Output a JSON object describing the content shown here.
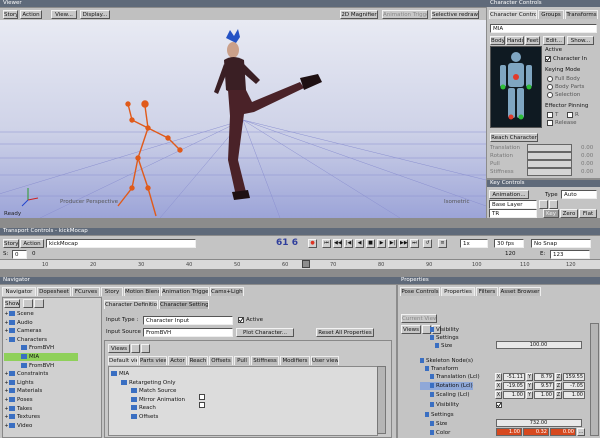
{
  "viewer": {
    "title": "Viewer",
    "menu": [
      "Story",
      "Action",
      "View...",
      "Display..."
    ],
    "right_buttons": [
      "2D Magnifier",
      "Animation Trigger",
      "Selective redraw"
    ],
    "status": "Ready",
    "producer_label": "Producer Perspective",
    "floor_label": "Isometric"
  },
  "character_controls": {
    "tabs": [
      "Character Controls",
      "Groups",
      "Transforms"
    ],
    "character_name": "MIA",
    "subtabs": [
      "Body",
      "Hands",
      "Feet",
      "Edit...",
      "Show..."
    ],
    "active_label": "Active",
    "character_in_label": "Character In",
    "keying_mode_label": "Keying Mode",
    "keying_options": [
      "Full Body",
      "Body Parts",
      "Selection"
    ],
    "effector_pinning_label": "Effector Pinning",
    "pin_t": "T",
    "pin_r": "R",
    "release_label": "Release",
    "reach_character_label": "Reach Character",
    "reach_rows": [
      {
        "label": "Translation",
        "value": "0.00"
      },
      {
        "label": "Rotation",
        "value": "0.00"
      },
      {
        "label": "Pull",
        "value": "0.00"
      },
      {
        "label": "Stiffness",
        "value": "0.00"
      }
    ]
  },
  "key_controls": {
    "title": "Key Controls",
    "animation_label": "Animation...",
    "type_label": "Type",
    "type_value": "Auto",
    "base_layer": "Base Layer",
    "tr_value": "TR",
    "key_buttons": [
      "Key",
      "Zero",
      "Flat"
    ],
    "mode_buttons": [
      "Zero",
      "Flat"
    ]
  },
  "transport": {
    "title": "Transport Controls - kickMocap",
    "story": "Story",
    "action": "Action",
    "take": "kickMocap",
    "frame_display": "61 6",
    "speed": "1x",
    "fps": "30 fps",
    "snap": "No Snap",
    "start_label": "S:",
    "start_value": "0",
    "end_label": "E:",
    "end_value": "123",
    "range_start": "0",
    "range_end": "120",
    "ruler_ticks": [
      "10",
      "20",
      "30",
      "40",
      "50",
      "60",
      "70",
      "80",
      "90",
      "100",
      "110",
      "120"
    ]
  },
  "navigator": {
    "title": "Navigator",
    "tabs": [
      "Navigator",
      "Dopesheet",
      "FCurves",
      "Story",
      "Motion Blend",
      "Animation Trigger",
      "Cams+Lights"
    ],
    "show_label": "Show",
    "tree": [
      {
        "label": "Scene",
        "indent": 0,
        "exp": "+"
      },
      {
        "label": "Audio",
        "indent": 0,
        "exp": "+"
      },
      {
        "label": "Cameras",
        "indent": 0,
        "exp": "+"
      },
      {
        "label": "Characters",
        "indent": 0,
        "exp": "-"
      },
      {
        "label": "FromBVH",
        "indent": 1,
        "exp": ""
      },
      {
        "label": "MIA",
        "indent": 1,
        "exp": "",
        "selected": true
      },
      {
        "label": "FromBVH",
        "indent": 1,
        "exp": ""
      },
      {
        "label": "Constraints",
        "indent": 0,
        "exp": "+"
      },
      {
        "label": "Lights",
        "indent": 0,
        "exp": "+"
      },
      {
        "label": "Materials",
        "indent": 0,
        "exp": "+"
      },
      {
        "label": "Poses",
        "indent": 0,
        "exp": "+"
      },
      {
        "label": "Takes",
        "indent": 0,
        "exp": "+"
      },
      {
        "label": "Textures",
        "indent": 0,
        "exp": "+"
      },
      {
        "label": "Video",
        "indent": 0,
        "exp": "+"
      }
    ],
    "char_tabs": [
      "Character Definition",
      "Character Settings"
    ],
    "input_type_label": "Input Type :",
    "input_type_value": "Character Input",
    "input_source_label": "Input Source :",
    "input_source_value": "FromBVH",
    "active_label": "Active",
    "plot_button": "Plot Character...",
    "reset_button": "Reset All Properties",
    "views_label": "Views",
    "view_tabs": [
      "Default view",
      "Parts view",
      "Actor",
      "Reach",
      "Offsets",
      "Pull",
      "Stiffness",
      "Modifiers",
      "User view"
    ],
    "props_tree": [
      {
        "label": "MIA",
        "indent": 0
      },
      {
        "label": "Retargeting Only",
        "indent": 1
      },
      {
        "label": "Match Source",
        "indent": 2
      },
      {
        "label": "Mirror Animation",
        "indent": 2
      },
      {
        "label": "Reach",
        "indent": 2
      },
      {
        "label": "Offsets",
        "indent": 2
      }
    ]
  },
  "properties": {
    "title": "Properties",
    "tabs": [
      "Pose Controls",
      "Properties",
      "Filters",
      "Asset Browser"
    ],
    "current_view": "Current View",
    "views_label": "Views",
    "rows": [
      {
        "label": "Visibility",
        "indent": 2
      },
      {
        "label": "Settings",
        "indent": 2
      },
      {
        "label": "Size",
        "indent": 3
      },
      {
        "label": "Skeleton Node(s)",
        "indent": 0
      },
      {
        "label": "Transform",
        "indent": 1
      },
      {
        "label": "Translation (Lcl)",
        "indent": 2
      },
      {
        "label": "Rotation (Lcl)",
        "indent": 2
      },
      {
        "label": "Scaling (Lcl)",
        "indent": 2
      },
      {
        "label": "Visibility",
        "indent": 2
      },
      {
        "label": "Settings",
        "indent": 1
      },
      {
        "label": "Size",
        "indent": 2
      },
      {
        "label": "Color",
        "indent": 2
      }
    ],
    "size_value_top": "100.00",
    "translation": [
      "-51.11",
      "8.79",
      "159.55"
    ],
    "rotation": [
      "-19.05",
      "9.57",
      "-7.05"
    ],
    "scaling": [
      "1.00",
      "1.00",
      "1.00"
    ],
    "size_value": "732.00",
    "color": [
      "1.00",
      "0.32",
      "0.00"
    ],
    "accent": "#d7491f"
  }
}
